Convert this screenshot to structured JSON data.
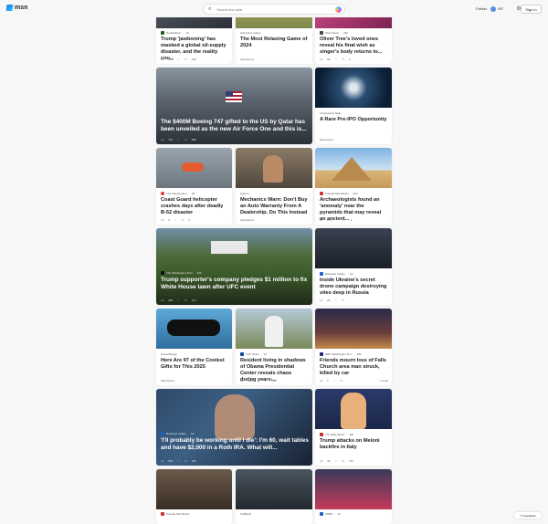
{
  "header": {
    "logo_text": "msn",
    "search_placeholder": "Search the web",
    "location": "Fairfax",
    "temperature": "89°",
    "signin_label": "Sign in"
  },
  "feedback_label": "Feedback",
  "cards": [
    {
      "source": "NewsNation",
      "age": "1d",
      "title": "Trump 'jawboning' has masked a global oil-supply disaster, and the reality cou...",
      "likes": "684",
      "comments": "378"
    },
    {
      "source": "Adventure Game",
      "title": "The Most Relaxing Game of 2024",
      "sponsored": "Sponsored"
    },
    {
      "source": "Pitch News",
      "age": "22h",
      "title": "Oliver Tree's loved ones reveal his final wish as singer's body returns to...",
      "likes": "83",
      "comments": "4"
    },
    {
      "source": "",
      "title": "The $400M Boeing 747 gifted to the US by Qatar has been unveiled as the new Air Force One and this is...",
      "likes": "743",
      "comments": "989"
    },
    {
      "source": "Investments Daily",
      "title": "A Rare Pre-IPO Opportunity",
      "sponsored": "Sponsored"
    },
    {
      "source": "The Independent",
      "age": "2d",
      "title": "Coast Guard helicopter crashes days after deadly B-52 disaster",
      "likes": "9",
      "comments": "2"
    },
    {
      "source": "Forbes",
      "title": "Mechanics Warn: Don't Buy an Auto Warranty From A Dealership, Do This Instead",
      "sponsored": "Sponsored"
    },
    {
      "source": "Popular Mechanics",
      "age": "22h",
      "title": "Archaeologists found an 'anomaly' near the pyramids that may reveal an ancient...",
      "likes": "271",
      "comments": "2"
    },
    {
      "source": "The Washington Post",
      "age": "13h",
      "title": "Trump supporter's company pledges $1 million to fix White House lawn after UFC event",
      "likes": "295",
      "comments": "174"
    },
    {
      "source": "Business Insider",
      "age": "1d",
      "title": "Inside Ukraine's secret drone campaign destroying sites deep in Russia",
      "likes": "22",
      "comments": ""
    },
    {
      "source": "Cleverlistings",
      "title": "Here Are 97 of the Coolest Gifts for This 2025",
      "sponsored": "Sponsored"
    },
    {
      "source": "FOX News",
      "age": "1d",
      "title": "Resident living in shadows of Obama Presidential Center reveals chaos during years-...",
      "likes": "748",
      "comments": "278"
    },
    {
      "source": "NBC Washington D.C.",
      "age": "19h",
      "title": "Friends mourn loss of Falls Church area man struck, killed by car",
      "likes": "1",
      "comments": "",
      "location": "Local"
    },
    {
      "source": "Business Insider",
      "age": "1d",
      "title": "'I'll probably be working until I die': I'm 60, wait tables and have $2,000 in a Roth IRA. What will...",
      "likes": "549",
      "comments": "108"
    },
    {
      "source": "The Daily Beast",
      "age": "14h",
      "title": "Trump attacks on Meloni backfire in Italy",
      "likes": "44",
      "comments": "747"
    },
    {
      "source": "Popular Mechanics",
      "title": ""
    },
    {
      "source": "SoftBank",
      "title": ""
    },
    {
      "source": "CNBC",
      "age": "1h",
      "title": ""
    }
  ]
}
